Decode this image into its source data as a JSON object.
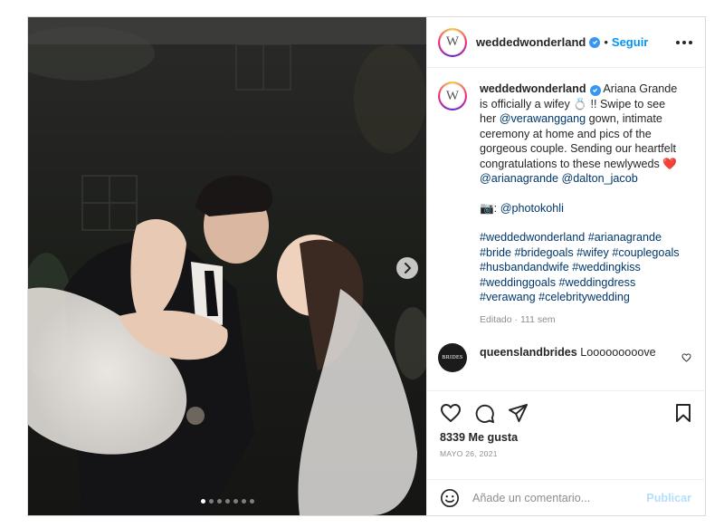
{
  "post": {
    "author": {
      "username": "weddedwonderland",
      "avatar_letter": "W",
      "verified": true
    },
    "follow_label": "Seguir",
    "header_separator": "•",
    "media": {
      "slide_count": 7,
      "current_slide": 1,
      "description_icon": "wedding-photo"
    },
    "caption": {
      "parts": [
        "Ariana Grande is officially a wifey 💍 !! Swipe to see her ",
        "@verawanggang",
        " gown, intimate ceremony at home and pics of the gorgeous couple. Sending our heartfelt congratulations to these newlyweds ",
        "❤️",
        " ",
        "@arianagrande",
        " ",
        "@dalton_jacob",
        "📷: ",
        "@photokohli",
        "#weddedwonderland #arianagrande #bride #bridegoals #wifey #couplegoals #husbandandwife #weddingkiss #weddinggoals #weddingdress #verawang #celebritywedding"
      ]
    },
    "edited_label": "Editado · 111 sem",
    "comments": [
      {
        "username": "queenslandbrides",
        "text": "Looooooooove",
        "avatar_text": "BRIDES"
      }
    ],
    "likes_label": "8339 Me gusta",
    "date_label": "MAYO 26, 2021",
    "comment_input": {
      "placeholder": "Añade un comentario..."
    },
    "publish_label": "Publicar",
    "colors": {
      "link": "#00376b",
      "accent": "#0095f6",
      "heart": "#ed4956"
    },
    "icons": [
      "verified-badge-icon",
      "more-options-icon",
      "next-slide-icon",
      "like-heart-icon",
      "comment-icon",
      "share-icon",
      "save-bookmark-icon",
      "emoji-icon",
      "comment-like-icon"
    ]
  }
}
